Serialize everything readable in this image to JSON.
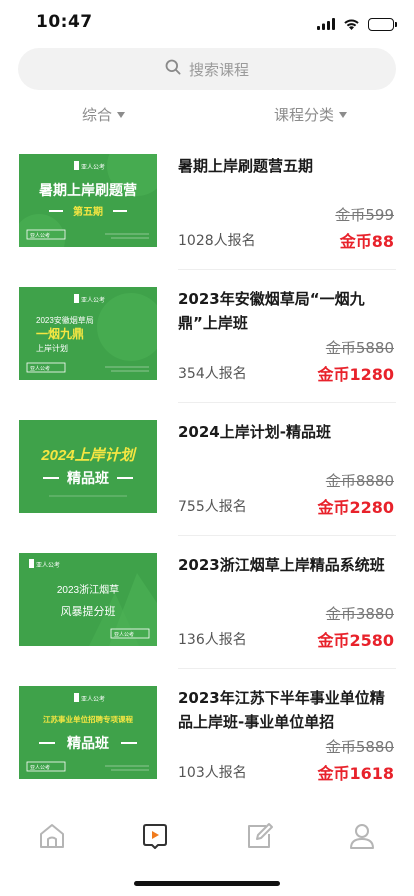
{
  "status": {
    "time": "10:47"
  },
  "search": {
    "placeholder": "搜索课程"
  },
  "filters": {
    "sort_label": "综合",
    "category_label": "课程分类"
  },
  "courses": [
    {
      "title": "暑期上岸刷题营五期",
      "enrolled": "1028人报名",
      "old_price": "金币599",
      "new_price": "金币88",
      "thumb": {
        "brand": "亚人公考",
        "headline": "暑期上岸刷题营",
        "subline": "第五期",
        "tag": "亚人公考"
      }
    },
    {
      "title": "2023年安徽烟草局“一烟九鼎”上岸班",
      "enrolled": "354人报名",
      "old_price": "金币5880",
      "new_price": "金币1280",
      "thumb": {
        "brand": "亚人公考",
        "line1": "2023安徽烟草局",
        "line2": "一烟九鼎",
        "line3": "上岸计划",
        "tag": "亚人公考"
      }
    },
    {
      "title": "2024上岸计划-精品班",
      "enrolled": "755人报名",
      "old_price": "金币8880",
      "new_price": "金币2280",
      "thumb": {
        "line1": "2024上岸计划",
        "line2": "精品班"
      }
    },
    {
      "title": "2023浙江烟草上岸精品系统班",
      "enrolled": "136人报名",
      "old_price": "金币3880",
      "new_price": "金币2580",
      "thumb": {
        "brand": "亚人公考",
        "line1": "2023浙江烟草",
        "line2": "风暴提分班",
        "tag": "亚人公考"
      }
    },
    {
      "title": "2023年江苏下半年事业单位精品上岸班-事业单位单招",
      "enrolled": "103人报名",
      "old_price": "金币5880",
      "new_price": "金币1618",
      "thumb": {
        "brand": "亚人公考",
        "line1": "江苏事业单位招聘专项课程",
        "line2": "精品班",
        "tag": "亚人公考"
      }
    }
  ],
  "tabs": [
    "home-icon",
    "video-course-icon",
    "edit-note-icon",
    "profile-icon"
  ],
  "colors": {
    "accent": "#e8222b",
    "thumb_green": "#3fa24a",
    "highlight_yellow": "#f5e642"
  }
}
